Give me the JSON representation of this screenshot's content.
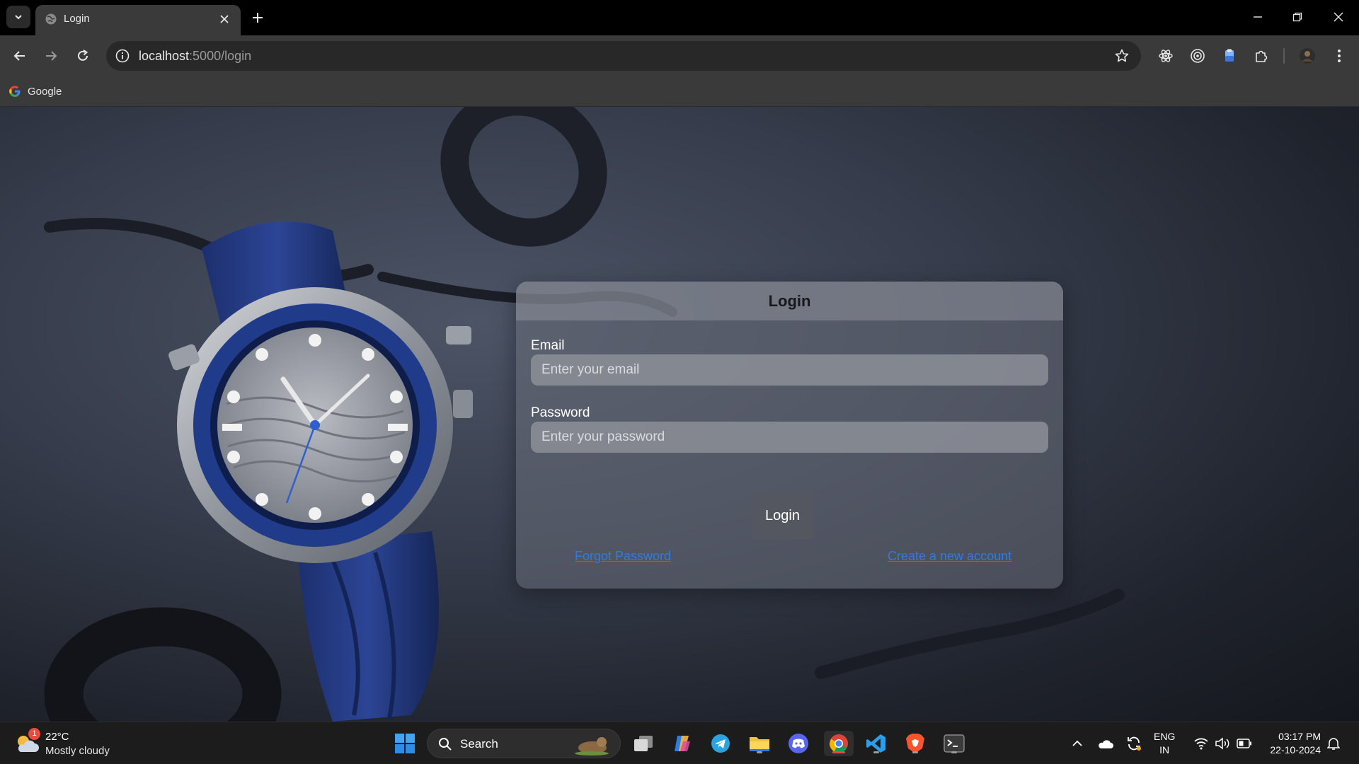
{
  "browser": {
    "tab": {
      "title": "Login"
    },
    "url": {
      "host": "localhost",
      "rest": ":5000/login"
    },
    "bookmarks": [
      {
        "label": "Google"
      }
    ]
  },
  "login": {
    "title": "Login",
    "email_label": "Email",
    "email_placeholder": "Enter your email",
    "password_label": "Password",
    "password_placeholder": "Enter your password",
    "submit_label": "Login",
    "forgot_link": "Forgot Password",
    "create_link": "Create a new account"
  },
  "taskbar": {
    "weather": {
      "temp": "22°C",
      "desc": "Mostly cloudy",
      "badge": "1"
    },
    "search_label": "Search",
    "language": {
      "line1": "ENG",
      "line2": "IN"
    },
    "clock": {
      "time": "03:17 PM",
      "date": "22-10-2024"
    }
  },
  "icons": [
    "tab-search-icon",
    "globe-icon",
    "close-icon",
    "plus-icon",
    "minimize-icon",
    "restore-icon",
    "back-icon",
    "forward-icon",
    "reload-icon",
    "info-icon",
    "star-icon",
    "react-devtools-icon",
    "target-icon",
    "clipboard-icon",
    "puzzle-icon",
    "profile-icon",
    "more-icon",
    "google-icon",
    "windows-start-icon",
    "search-icon",
    "task-view-icon",
    "copilot-icon",
    "telegram-icon",
    "file-explorer-icon",
    "discord-icon",
    "chrome-icon",
    "vscode-icon",
    "brave-icon",
    "terminal-icon",
    "chevron-up-icon",
    "cloud-icon",
    "sync-icon",
    "wifi-icon",
    "volume-icon",
    "battery-icon",
    "bell-icon"
  ],
  "colors": {
    "link": "#2f7be0",
    "accent_blue": "#1f3b8a"
  }
}
